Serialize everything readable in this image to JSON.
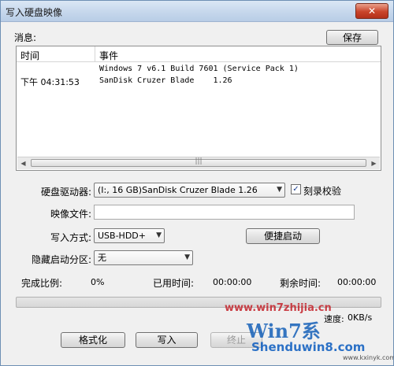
{
  "window": {
    "title": "写入硬盘映像",
    "close": "✕"
  },
  "messages": {
    "label": "消息:",
    "save_label": "保存",
    "columns": [
      "时间",
      "事件"
    ],
    "rows": [
      {
        "time": "",
        "event": "Windows 7 v6.1 Build 7601 (Service Pack 1)"
      },
      {
        "time": "下午 04:31:53",
        "event": "SanDisk Cruzer Blade    1.26"
      }
    ],
    "scroll_grip": "|||"
  },
  "form": {
    "drive_label": "硬盘驱动器:",
    "drive_value": "(I:, 16 GB)SanDisk Cruzer Blade    1.26",
    "verify_label": "刻录校验",
    "verify_checked": "✓",
    "image_label": "映像文件:",
    "image_value": "",
    "write_mode_label": "写入方式:",
    "write_mode_value": "USB-HDD+",
    "quick_boot_label": "便捷启动",
    "hidden_partition_label": "隐藏启动分区:",
    "hidden_partition_value": "无"
  },
  "status": {
    "completion_label": "完成比例:",
    "completion_value": "0%",
    "completion_fraction": 0,
    "elapsed_label": "已用时间:",
    "elapsed_value": "00:00:00",
    "remaining_label": "剩余时间:",
    "remaining_value": "00:00:00",
    "speed_label": "速度:",
    "speed_value": "0KB/s"
  },
  "buttons": {
    "format": "格式化",
    "write": "写入",
    "stop": "终止"
  },
  "watermark": {
    "top": "www.win7zhijia.cn",
    "logo": "Win7系",
    "bottom": "Shenduwin8.com",
    "url": "www.kxinyk.com"
  },
  "colors": {
    "progress_fill": "#3bbd3b",
    "accent": "#1560b8"
  }
}
